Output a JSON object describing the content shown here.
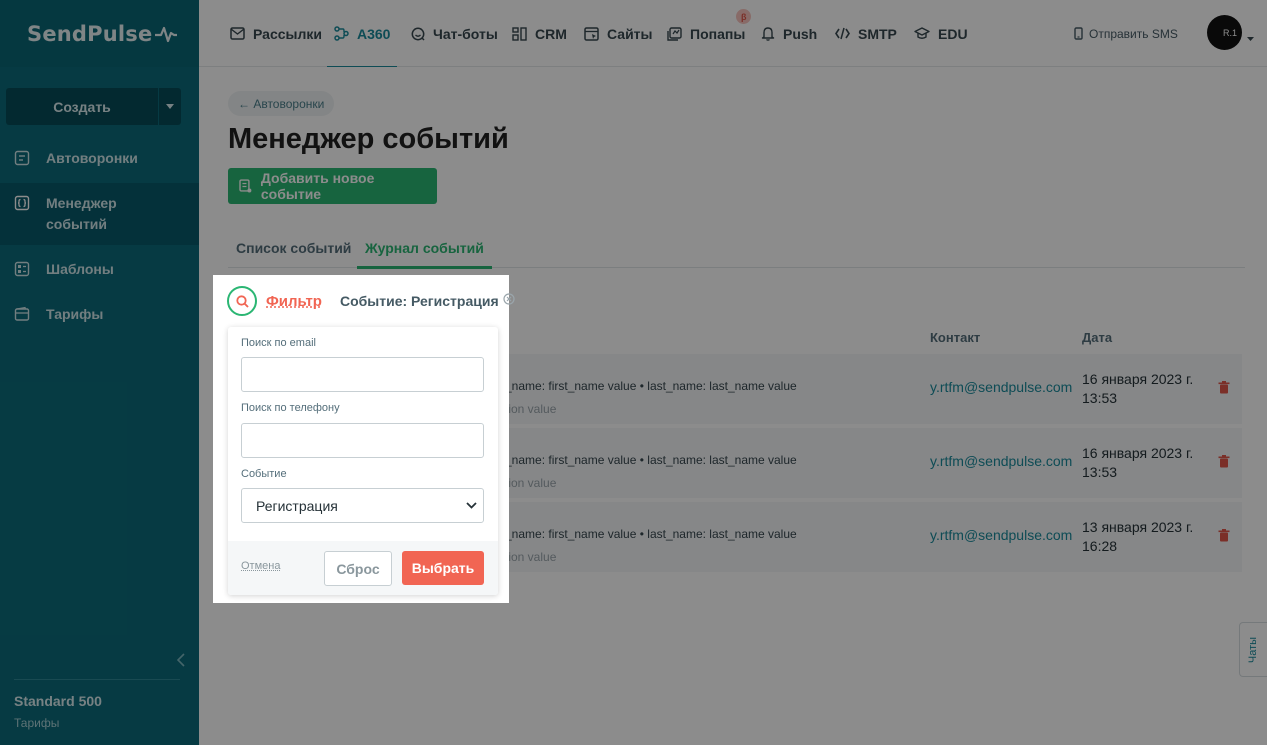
{
  "sidebar": {
    "logo": "SendPulse",
    "create_label": "Создать",
    "items": [
      {
        "label": "Автоворонки",
        "icon": "funnel-icon"
      },
      {
        "label": "Менеджер событий",
        "icon": "events-icon"
      },
      {
        "label": "Шаблоны",
        "icon": "templates-icon"
      },
      {
        "label": "Тарифы",
        "icon": "wallet-icon"
      }
    ],
    "plan_name": "Standard 500",
    "plan_link": "Тарифы"
  },
  "topbar": {
    "nav": [
      {
        "label": "Рассылки",
        "icon": "mail-icon"
      },
      {
        "label": "A360",
        "icon": "automation-icon"
      },
      {
        "label": "Чат-боты",
        "icon": "chatbot-icon"
      },
      {
        "label": "CRM",
        "icon": "crm-icon"
      },
      {
        "label": "Сайты",
        "icon": "sites-icon"
      },
      {
        "label": "Попапы",
        "icon": "popups-icon",
        "badge": "β"
      },
      {
        "label": "Push",
        "icon": "bell-icon"
      },
      {
        "label": "SMTP",
        "icon": "code-icon"
      },
      {
        "label": "EDU",
        "icon": "graduation-icon"
      }
    ],
    "active_nav": "A360",
    "sms_label": "Отправить SMS",
    "avatar_text": "R.1"
  },
  "main": {
    "back_label": "← Автоворонки",
    "title": "Менеджер событий",
    "add_button": "Добавить новое событие",
    "tabs": [
      "Список событий",
      "Журнал событий"
    ],
    "active_tab": "Журнал событий",
    "columns": {
      "contact": "Контакт",
      "date": "Дата"
    },
    "rows": [
      {
        "props": "_name: first_name value • last_name: last_name value",
        "props2": "tion value",
        "contact": "y.rtfm@sendpulse.com",
        "date": "16 января 2023 г. 13:53"
      },
      {
        "props": "_name: first_name value • last_name: last_name value",
        "props2": "tion value",
        "contact": "y.rtfm@sendpulse.com",
        "date": "16 января 2023 г. 13:53"
      },
      {
        "props": "_name: first_name value • last_name: last_name value",
        "props2": "tion value",
        "contact": "y.rtfm@sendpulse.com",
        "date": "13 января 2023 г. 16:28"
      }
    ],
    "chats_tab": "Чаты"
  },
  "filter": {
    "link_label": "Фильтр",
    "chip_label": "Событие: Регистрация",
    "email_label": "Поиск по email",
    "email_value": "",
    "phone_label": "Поиск по телефону",
    "phone_value": "",
    "event_label": "Событие",
    "event_selected": "Регистрация",
    "cancel_label": "Отмена",
    "reset_label": "Сброс",
    "select_label": "Выбрать"
  },
  "colors": {
    "sidebar": "#0b6b7a",
    "accent_green": "#2bb673",
    "accent_teal": "#1a8a9c",
    "accent_red": "#f16553"
  }
}
